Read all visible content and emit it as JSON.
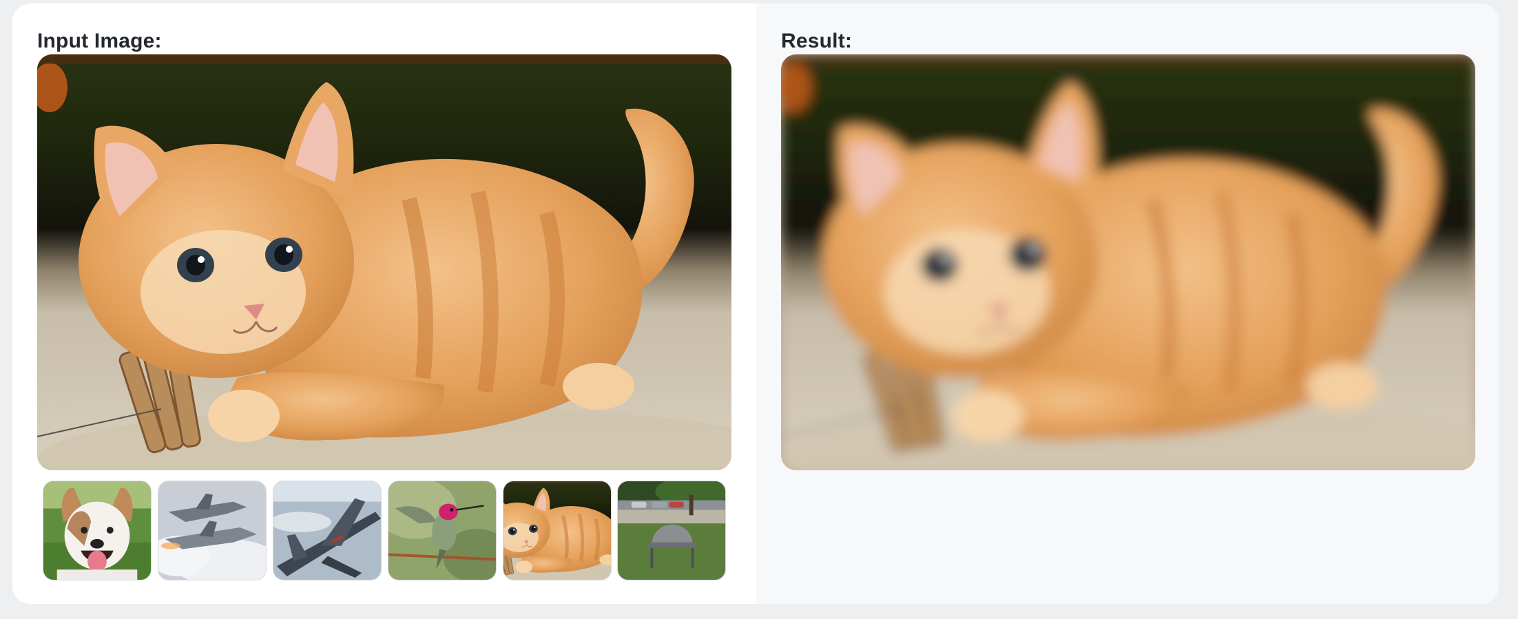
{
  "input_panel": {
    "label": "Input Image:",
    "image_icon": "kitten-photo"
  },
  "result_panel": {
    "label": "Result:",
    "image_icon": "kitten-photo-blurred"
  },
  "examples": [
    {
      "icon": "dog-photo"
    },
    {
      "icon": "fighter-jets-photo"
    },
    {
      "icon": "jet-aircraft-photo"
    },
    {
      "icon": "hummingbird-photo"
    },
    {
      "icon": "kitten-photo"
    },
    {
      "icon": "park-bench-photo"
    }
  ],
  "colors": {
    "page_background": "#eeeff1",
    "input_panel_background": "#ffffff",
    "result_panel_background": "#f7f8fa",
    "label_text": "#24282e",
    "kitten_fur": "#e7a35c"
  }
}
